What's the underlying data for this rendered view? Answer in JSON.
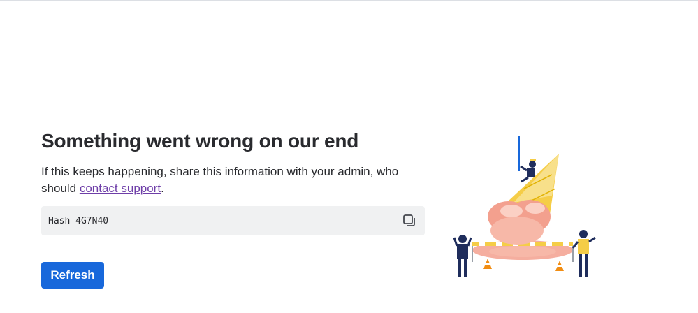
{
  "error": {
    "title": "Something went wrong on our end",
    "message_prefix": "If this keeps happening, share this information with your admin, who should ",
    "support_link": "contact support",
    "message_suffix": ".",
    "hash": "Hash 4G7N40"
  },
  "actions": {
    "refresh_label": "Refresh",
    "copy_icon": "copy-icon"
  },
  "colors": {
    "primary": "#1868db",
    "link": "#6e3ea8",
    "hash_bg": "#f0f1f2",
    "text": "#292a2e"
  },
  "illustration": {
    "name": "melted-ice-cream-cone-with-workers"
  }
}
